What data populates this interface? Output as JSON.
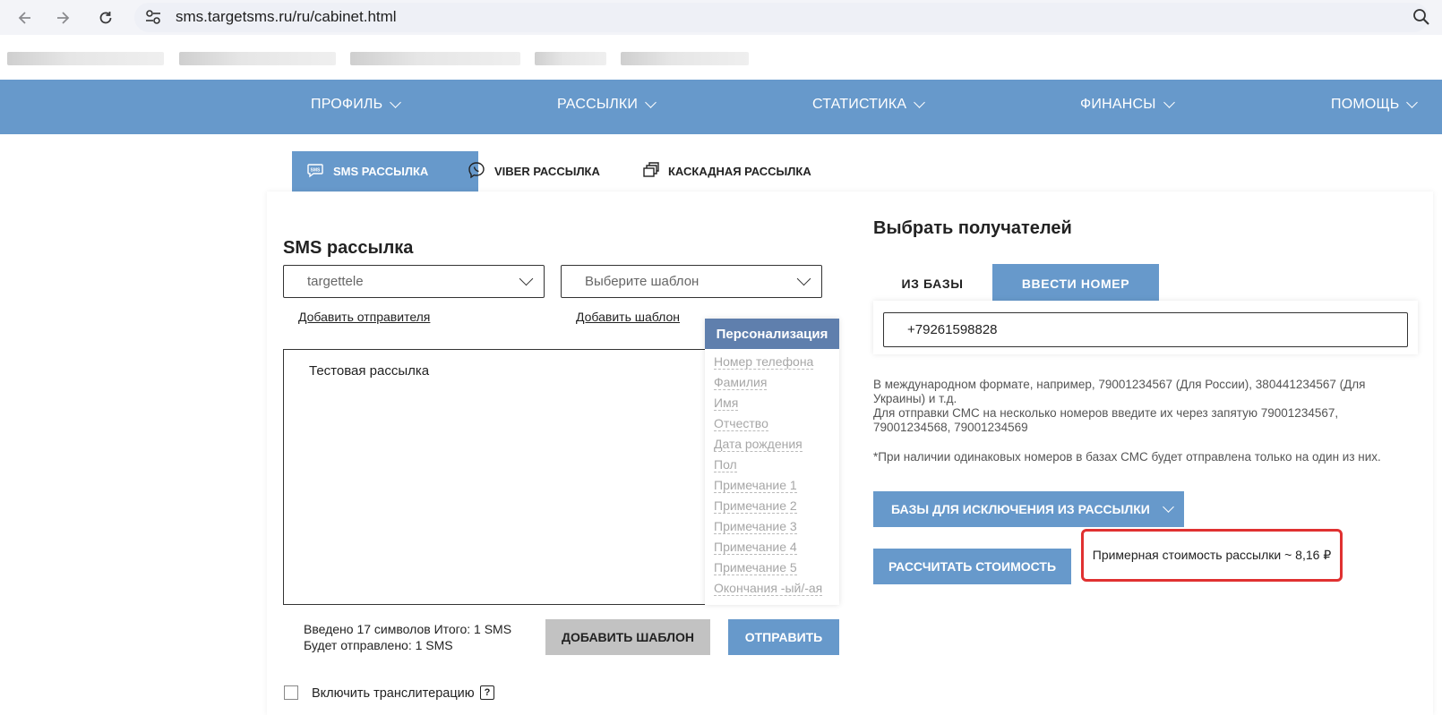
{
  "browser": {
    "url": "sms.targetsms.ru/ru/cabinet.html"
  },
  "topnav": {
    "items": [
      {
        "label": "ПРОФИЛЬ"
      },
      {
        "label": "РАССЫЛКИ"
      },
      {
        "label": "СТАТИСТИКА"
      },
      {
        "label": "ФИНАНСЫ"
      },
      {
        "label": "ПОМОЩЬ"
      }
    ]
  },
  "tabs": [
    {
      "label": "SMS РАССЫЛКА",
      "icon": "sms-chat-icon",
      "active": true
    },
    {
      "label": "VIBER РАССЫЛКА",
      "icon": "viber-icon",
      "active": false
    },
    {
      "label": "КАСКАДНАЯ РАССЫЛКА",
      "icon": "cascade-icon",
      "active": false
    }
  ],
  "sms": {
    "title": "SMS рассылка",
    "sender_value": "targettele",
    "template_placeholder": "Выберите шаблон",
    "add_sender_link": "Добавить отправителя",
    "add_template_link": "Добавить шаблон",
    "message_text": "Тестовая рассылка",
    "counter_line1": "Введено 17  символов Итого: 1  SMS",
    "counter_line2": "Будет отправлено: 1  SMS",
    "add_template_button": "ДОБАВИТЬ ШАБЛОН",
    "send_button": "ОТПРАВИТЬ",
    "translit_label": "Включить транслитерацию",
    "help_mark": "?"
  },
  "personalization": {
    "title": "Персонализация",
    "items": [
      "Номер телефона",
      "Фамилия",
      "Имя",
      "Отчество",
      "Дата рождения",
      "Пол",
      "Примечание 1",
      "Примечание 2",
      "Примечание 3",
      "Примечание 4",
      "Примечание 5",
      "Окончания -ый/-ая"
    ]
  },
  "recipients": {
    "title": "Выбрать получателей",
    "tab_from_base": "ИЗ БАЗЫ",
    "tab_enter_number": "ВВЕСТИ НОМЕР",
    "phone_value": "+79261598828",
    "hint_line1": "В международном формате, например, 79001234567 (Для России), 380441234567 (Для Украины) и т.д.",
    "hint_line2": "Для отправки СМС на несколько номеров введите их через запятую 79001234567, 79001234568, 79001234569",
    "hint_note": "*При наличии одинаковых номеров в базах СМС будет отправлена только на один из них.",
    "exclude_button": "БАЗЫ ДЛЯ ИСКЛЮЧЕНИЯ ИЗ РАССЫЛКИ",
    "calc_button": "РАССЧИТАТЬ СТОИМОСТЬ",
    "cost_text": "Примерная стоимость рассылки ~ 8,16 ₽"
  },
  "colors": {
    "accent": "#6799cb",
    "persona_header": "#5f7fad",
    "highlight": "#e03131"
  }
}
